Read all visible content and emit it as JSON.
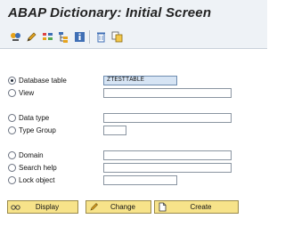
{
  "window": {
    "title": "ABAP Dictionary: Initial Screen"
  },
  "toolbar": {
    "icons": [
      "where-used-icon",
      "edit-pencil-icon",
      "object-list-icon",
      "hierarchy-icon",
      "info-icon",
      "delete-icon",
      "copy-icon"
    ]
  },
  "form": {
    "database_table": {
      "label": "Database table",
      "value": "ZTESTTABLE",
      "selected": true
    },
    "view": {
      "label": "View",
      "value": ""
    },
    "data_type": {
      "label": "Data type",
      "value": ""
    },
    "type_group": {
      "label": "Type Group",
      "value": ""
    },
    "domain": {
      "label": "Domain",
      "value": ""
    },
    "search_help": {
      "label": "Search help",
      "value": ""
    },
    "lock_object": {
      "label": "Lock object",
      "value": ""
    }
  },
  "buttons": {
    "display": "Display",
    "change": "Change",
    "create": "Create"
  },
  "colors": {
    "button_fill": "#f7e38a",
    "toolbar_bg": "#eef2f6",
    "active_field_bg": "#d6e4f4"
  }
}
